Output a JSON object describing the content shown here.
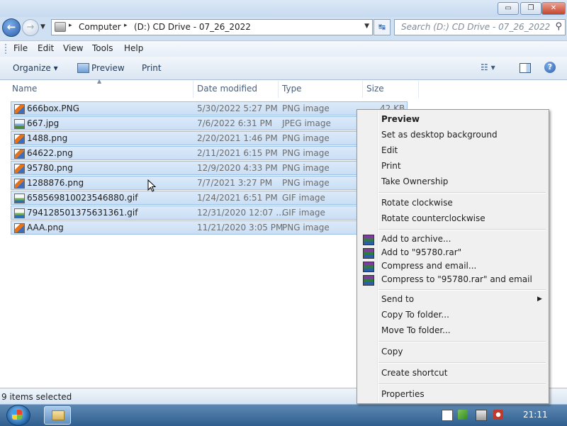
{
  "window": {
    "controls": {
      "minimize": "▭",
      "maximize": "❐",
      "close": "✕"
    }
  },
  "navigation": {
    "back": "←",
    "forward": "→",
    "history_dropdown": "▼",
    "address": {
      "crumbs": [
        "Computer",
        "(D:) CD Drive - 07_26_2022"
      ],
      "separator": "▸",
      "dropdown": "▼"
    },
    "refresh": "↹",
    "search_placeholder": "Search (D:) CD Drive - 07_26_2022",
    "search_icon": "⚲"
  },
  "menubar": {
    "items": [
      "File",
      "Edit",
      "View",
      "Tools",
      "Help"
    ]
  },
  "toolbar": {
    "organize": "Organize ▾",
    "preview": "Preview",
    "print": "Print",
    "views_icon": "☷ ▾",
    "help": "?"
  },
  "columns": [
    "Name",
    "Date modified",
    "Type",
    "Size"
  ],
  "sort_indicator": "▲",
  "files": [
    {
      "name": "666box.PNG",
      "date": "5/30/2022 5:27 PM",
      "type": "PNG image",
      "size": "42 KB",
      "icon": "png"
    },
    {
      "name": "667.jpg",
      "date": "7/6/2022 6:31 PM",
      "type": "JPEG image",
      "size": "",
      "icon": "jpg"
    },
    {
      "name": "1488.png",
      "date": "2/20/2021 1:46 PM",
      "type": "PNG image",
      "size": "",
      "icon": "png"
    },
    {
      "name": "64622.png",
      "date": "2/11/2021 6:15 PM",
      "type": "PNG image",
      "size": "",
      "icon": "png"
    },
    {
      "name": "95780.png",
      "date": "12/9/2020 4:33 PM",
      "type": "PNG image",
      "size": "",
      "icon": "png"
    },
    {
      "name": "1288876.png",
      "date": "7/7/2021 3:27 PM",
      "type": "PNG image",
      "size": "",
      "icon": "png"
    },
    {
      "name": "658569810023546880.gif",
      "date": "1/24/2021 6:51 PM",
      "type": "GIF image",
      "size": "",
      "icon": "gif"
    },
    {
      "name": "794128501375631361.gif",
      "date": "12/31/2020 12:07 ...",
      "type": "GIF image",
      "size": "",
      "icon": "gif"
    },
    {
      "name": "AAA.png",
      "date": "11/21/2020 3:05 PM",
      "type": "PNG image",
      "size": "",
      "icon": "png"
    }
  ],
  "status": {
    "text": "9 items selected"
  },
  "context_menu": {
    "group1": [
      "Preview",
      "Set as desktop background",
      "Edit",
      "Print",
      "Take Ownership"
    ],
    "group2": [
      "Rotate clockwise",
      "Rotate counterclockwise"
    ],
    "group3": [
      "Add to archive...",
      "Add to \"95780.rar\"",
      "Compress and email...",
      "Compress to \"95780.rar\" and email"
    ],
    "group4": [
      "Send to",
      "Copy To folder...",
      "Move To folder..."
    ],
    "submenu_arrow": "▶",
    "group5": [
      "Copy"
    ],
    "group6": [
      "Create shortcut"
    ],
    "group7": [
      "Properties"
    ]
  },
  "taskbar": {
    "clock": "21:11"
  }
}
